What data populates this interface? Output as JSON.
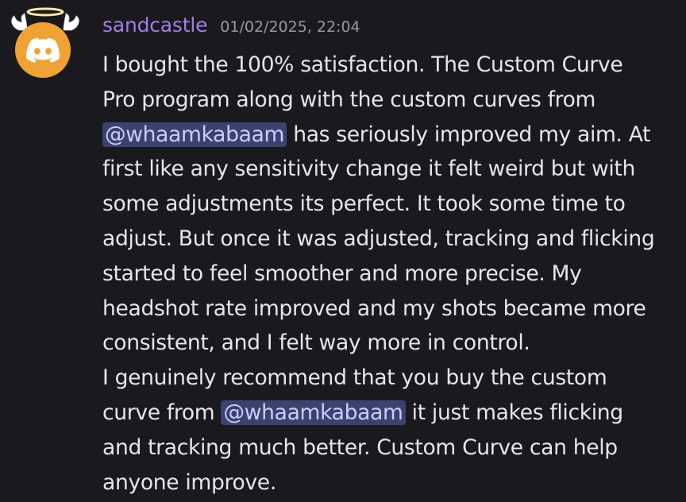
{
  "author": {
    "username": "sandcastle",
    "avatar_icon": "discord-logo-icon",
    "decoration": "angel-halo-wings-decoration",
    "avatar_color": "#f0a232",
    "username_color": "#a07ee9"
  },
  "timestamp": "01/02/2025, 22:04",
  "lines": [
    {
      "pre": "I bought the 100% satisfaction. The Custom Curve"
    },
    {
      "pre": "Pro program along with the custom curves from"
    },
    {
      "mention": "@whaamkabaam",
      "post": " has seriously improved my aim. At"
    },
    {
      "pre": "first like any sensitivity change it felt weird but with"
    },
    {
      "pre": "some adjustments its perfect. It took some time to"
    },
    {
      "pre": "adjust. But once it was adjusted, tracking and flicking"
    },
    {
      "pre": "started to feel smoother and more precise. My"
    },
    {
      "pre": "headshot rate improved and my shots became more"
    },
    {
      "pre": "consistent, and I felt way more in control."
    },
    {
      "pre": "I genuinely recommend that you buy the custom"
    },
    {
      "pre": "curve from ",
      "mention": "@whaamkabaam",
      "post": " it just makes flicking"
    },
    {
      "pre": "and tracking much better. Custom Curve can help"
    },
    {
      "pre": "anyone improve."
    }
  ]
}
